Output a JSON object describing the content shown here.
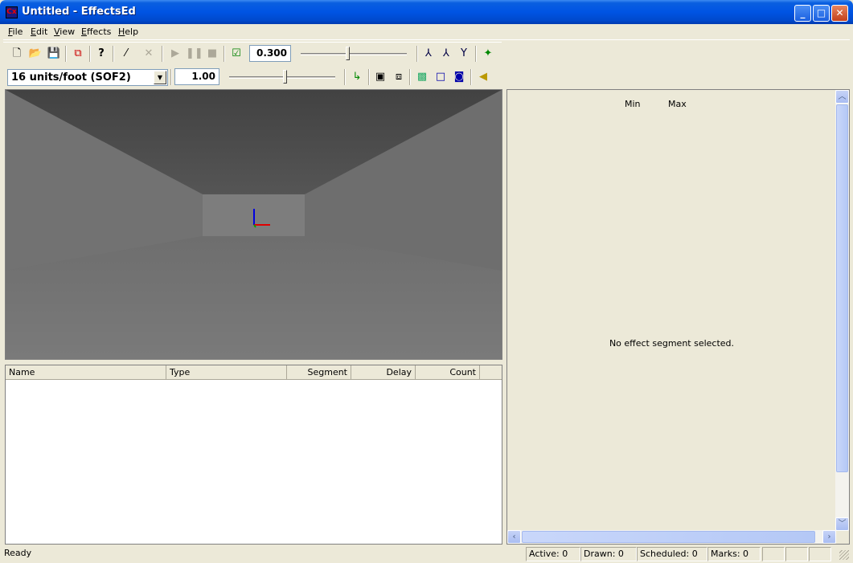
{
  "window": {
    "title": "Untitled - EffectsEd",
    "icon_text": "Cx"
  },
  "menu": [
    "File",
    "Edit",
    "View",
    "Effects",
    "Help"
  ],
  "toolbar1": {
    "time_value": "0.300",
    "time_slider": 0.45
  },
  "toolbar2": {
    "units_selected": "16 units/foot (SOF2)",
    "scale_value": "1.00",
    "scale_slider": 0.53
  },
  "effects_list": {
    "columns": [
      "Name",
      "Type",
      "Segment",
      "Delay",
      "Count"
    ],
    "rows": []
  },
  "properties_panel": {
    "min_label": "Min",
    "max_label": "Max",
    "empty_message": "No effect segment selected."
  },
  "status": {
    "ready": "Ready",
    "active": "Active: 0",
    "drawn": "Drawn: 0",
    "scheduled": "Scheduled: 0",
    "marks": "Marks: 0"
  },
  "colors": {
    "titlebar": "#0054e3",
    "axis_x": "#e00000",
    "axis_y": "#0000e0",
    "axis_z": "#00a000"
  }
}
